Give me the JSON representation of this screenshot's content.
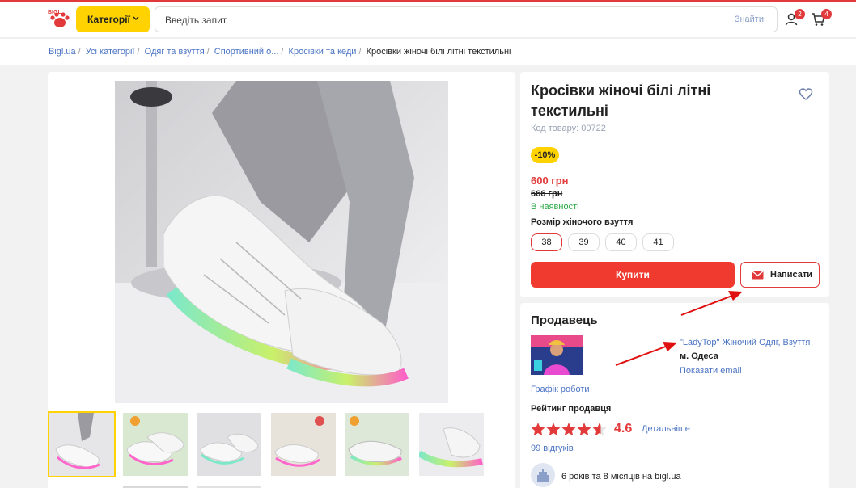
{
  "header": {
    "logo_text": "BIGL",
    "categories_label": "Категорії",
    "search_placeholder": "Введіть запит",
    "search_button": "Знайти",
    "user_badge": "2",
    "cart_badge": "4"
  },
  "breadcrumbs": [
    "Bigl.ua",
    "Усі категорії",
    "Одяг та взуття",
    "Спортивний о...",
    "Кросівки та кеди",
    "Кросівки жіночі білі літні текстильні"
  ],
  "product": {
    "title": "Кросівки жіночі білі літні текстильні",
    "sku": "Код товару: 00722",
    "discount": "-10%",
    "price": "600 грн",
    "old_price": "666 грн",
    "stock": "В наявності",
    "size_label": "Розмір жіночого взуття",
    "sizes": [
      "38",
      "39",
      "40",
      "41"
    ],
    "selected_size": "38",
    "buy_label": "Купити",
    "write_label": "Написати"
  },
  "seller": {
    "title": "Продавець",
    "name": "\"LadyTop\" Жіночий Одяг, Взуття",
    "city": "м. Одеса",
    "email_link": "Показати email",
    "schedule_link": "Графік роботи",
    "rating_label": "Рейтинг продавця",
    "rating": 4.6,
    "rating_text": "4.6",
    "details_link": "Детальніше",
    "reviews": "99 відгуків",
    "years": "6 років та 8 місяців на bigl.ua"
  },
  "colors": {
    "accent_yellow": "#ffd200",
    "accent_red": "#f13a2f",
    "link_blue": "#4a73c3",
    "stock_green": "#28a745"
  }
}
